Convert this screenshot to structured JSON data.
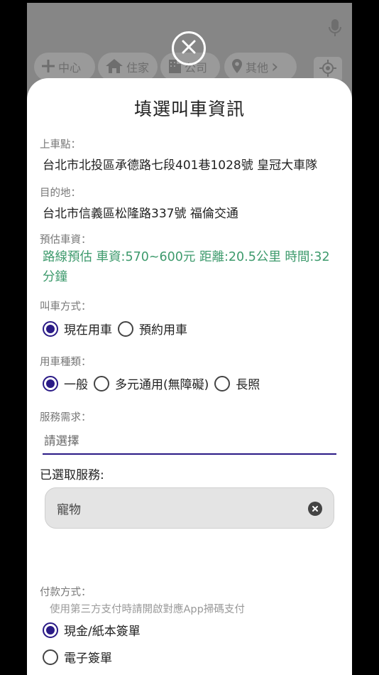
{
  "map": {
    "chips": [
      {
        "label": "中心",
        "icon": "plus-icon"
      },
      {
        "label": "住家",
        "icon": "home-icon"
      },
      {
        "label": "公司",
        "icon": "building-icon"
      },
      {
        "label": "其他",
        "icon": "pin-icon"
      }
    ],
    "other_chevron": "›"
  },
  "sheet": {
    "title": "填選叫車資訊",
    "pickup_label": "上車點：",
    "pickup_value": "台北市北投區承德路七段401巷1028號 皇冠大車隊",
    "destination_label": "目的地：",
    "destination_value": "台北市信義區松隆路337號 福倫交通",
    "fare_label": "預估車資：",
    "fare_value": "路線預估 車資:570~600元 距離:20.5公里 時間:32分鐘",
    "call_mode_label": "叫車方式：",
    "call_modes": [
      {
        "label": "現在用車",
        "selected": true
      },
      {
        "label": "預約用車",
        "selected": false
      }
    ],
    "vehicle_type_label": "用車種類：",
    "vehicle_types": [
      {
        "label": "一般",
        "selected": true
      },
      {
        "label": "多元通用(無障礙)",
        "selected": false
      },
      {
        "label": "長照",
        "selected": false
      }
    ],
    "service_label": "服務需求：",
    "service_placeholder": "請選擇",
    "selected_services_label": "已選取服務:",
    "selected_services": [
      "寵物"
    ],
    "payment_label": "付款方式：",
    "payment_hint": "使用第三方支付時請開啟對應App掃碼支付",
    "payment_methods": [
      {
        "label": "現金/紙本簽單",
        "selected": true
      },
      {
        "label": "電子簽單",
        "selected": false
      }
    ]
  },
  "colors": {
    "accent": "#2a1a86",
    "fare_green": "#3d9a6c"
  }
}
